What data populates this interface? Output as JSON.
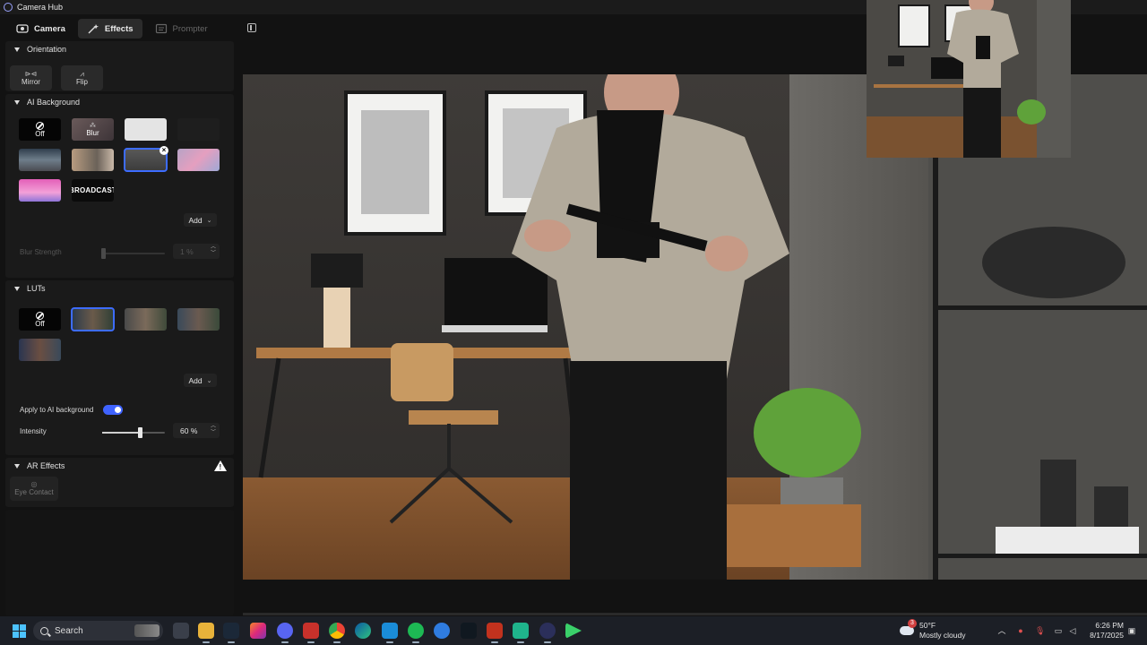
{
  "window": {
    "title": "Camera Hub"
  },
  "tabs": [
    {
      "label": "Camera",
      "icon": "camera-icon",
      "state": "normal"
    },
    {
      "label": "Effects",
      "icon": "magic-wand-icon",
      "state": "active"
    },
    {
      "label": "Prompter",
      "icon": "prompter-icon",
      "state": "disabled"
    }
  ],
  "orientation": {
    "heading": "Orientation",
    "mirror_label": "Mirror",
    "flip_label": "Flip"
  },
  "ai_background": {
    "heading": "AI Background",
    "off_label": "Off",
    "blur_label": "Blur",
    "broadcast_label": "BROADCAST",
    "add_label": "Add",
    "blur_strength_label": "Blur Strength",
    "blur_strength_value": "1 %",
    "blur_strength_level": 0.01
  },
  "luts": {
    "heading": "LUTs",
    "off_label": "Off",
    "add_label": "Add",
    "apply_label": "Apply to AI background",
    "apply_enabled": true,
    "intensity_label": "Intensity",
    "intensity_value": "60 %",
    "intensity_level": 0.6
  },
  "ar_effects": {
    "heading": "AR Effects",
    "eye_contact_label": "Eye Contact"
  },
  "taskbar": {
    "search_placeholder": "Search",
    "weather_badge": "3",
    "temperature": "50°F",
    "condition": "Mostly cloudy",
    "time": "6:26 PM",
    "date": "8/17/2025"
  },
  "colors": {
    "accent": "#3d6cff",
    "toggle": "#3f63ff"
  }
}
